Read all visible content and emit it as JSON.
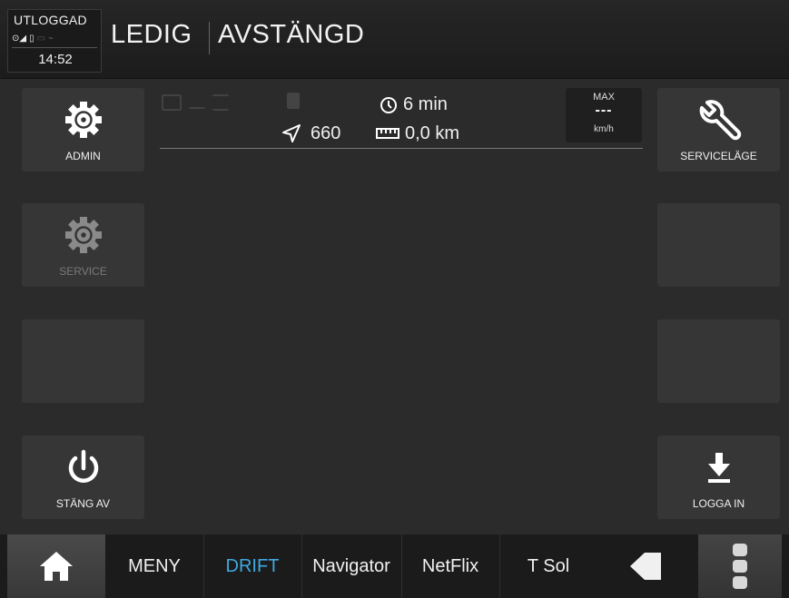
{
  "status": {
    "login_state": "UTLOGGAD",
    "time": "14:52"
  },
  "header": {
    "status": "LEDIG",
    "mode": "AVSTÄNGD"
  },
  "info": {
    "duration": "6 min",
    "position": "660",
    "distance": "0,0 km",
    "speed_max_label": "MAX",
    "speed_value": "---",
    "speed_unit": "km/h"
  },
  "left_buttons": [
    {
      "label": "ADMIN",
      "icon": "gear-icon"
    },
    {
      "label": "SERVICE",
      "icon": "gear-icon"
    },
    {
      "label": "",
      "icon": ""
    },
    {
      "label": "STÄNG AV",
      "icon": "power-icon"
    }
  ],
  "right_buttons": [
    {
      "label": "SERVICELÄGE",
      "icon": "wrench-icon"
    },
    {
      "label": "",
      "icon": ""
    },
    {
      "label": "",
      "icon": ""
    },
    {
      "label": "LOGGA IN",
      "icon": "download-icon"
    }
  ],
  "nav": {
    "items": [
      "MENY",
      "DRIFT",
      "Navigator",
      "NetFlix",
      "T Sol"
    ],
    "active": "DRIFT",
    "active_color": "#3fa9e0"
  }
}
